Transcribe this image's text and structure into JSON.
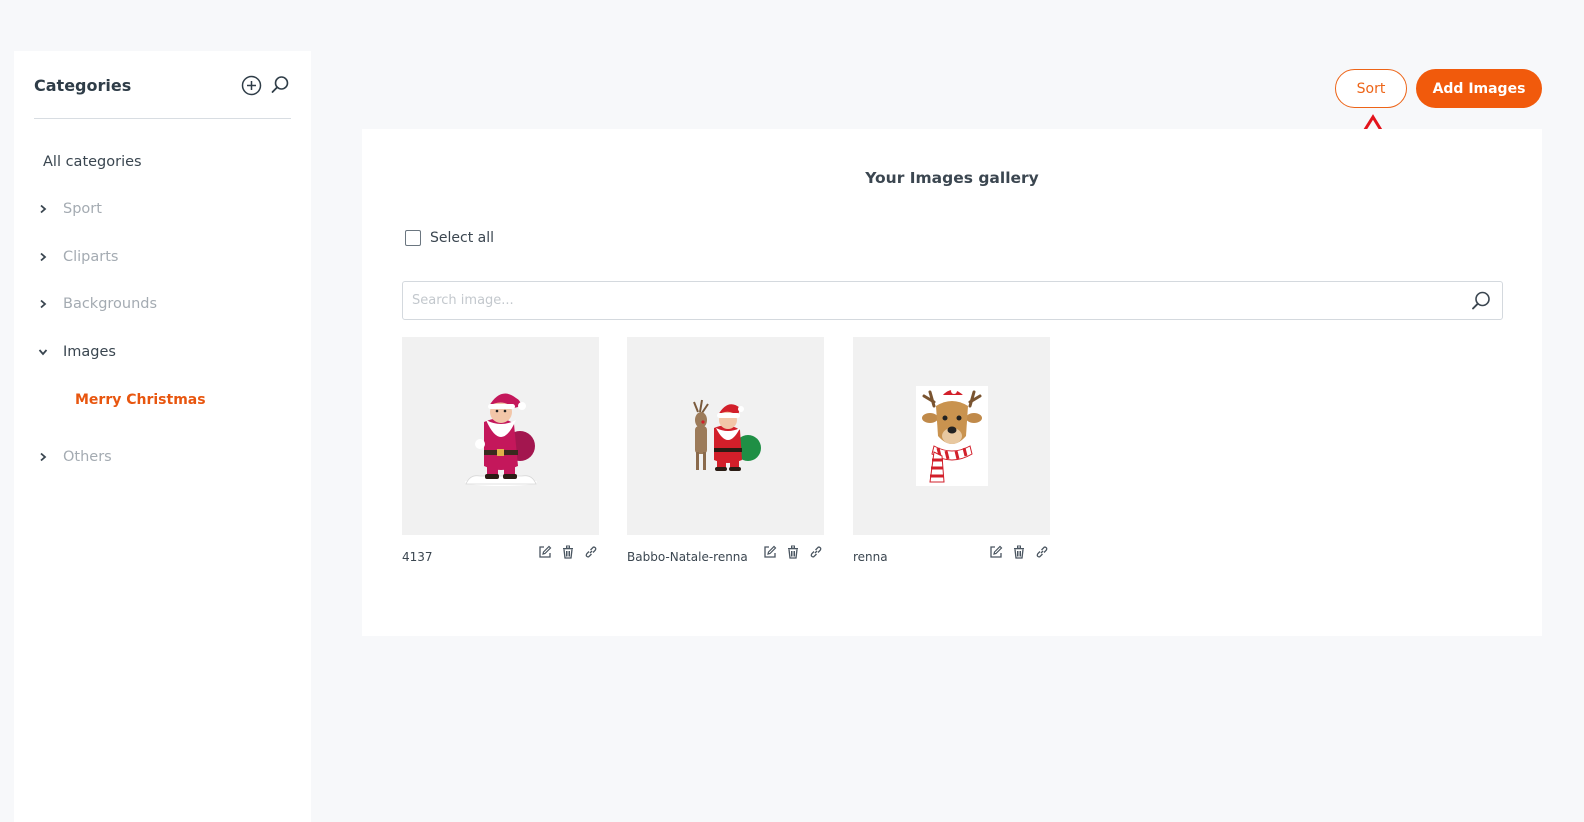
{
  "sidebar": {
    "title": "Categories",
    "all_label": "All categories",
    "categories": [
      {
        "label": "Sport",
        "expanded": false
      },
      {
        "label": "Cliparts",
        "expanded": false
      },
      {
        "label": "Backgrounds",
        "expanded": false
      },
      {
        "label": "Images",
        "expanded": true
      },
      {
        "label": "Others",
        "expanded": false
      }
    ],
    "active_subcategory": "Merry Christmas"
  },
  "toolbar": {
    "sort_label": "Sort",
    "add_images_label": "Add Images"
  },
  "gallery": {
    "title": "Your Images gallery",
    "select_all_label": "Select all",
    "search_placeholder": "Search image...",
    "images": [
      {
        "name": "4137",
        "subject": "santa-claus-with-sack"
      },
      {
        "name": "Babbo-Natale-renna",
        "subject": "santa-with-reindeer"
      },
      {
        "name": "renna",
        "subject": "reindeer-with-scarf"
      }
    ]
  },
  "colors": {
    "accent": "#f15a0c",
    "active_text": "#e8560f",
    "annotation": "#e3141c",
    "page_bg": "#f7f8fa"
  }
}
